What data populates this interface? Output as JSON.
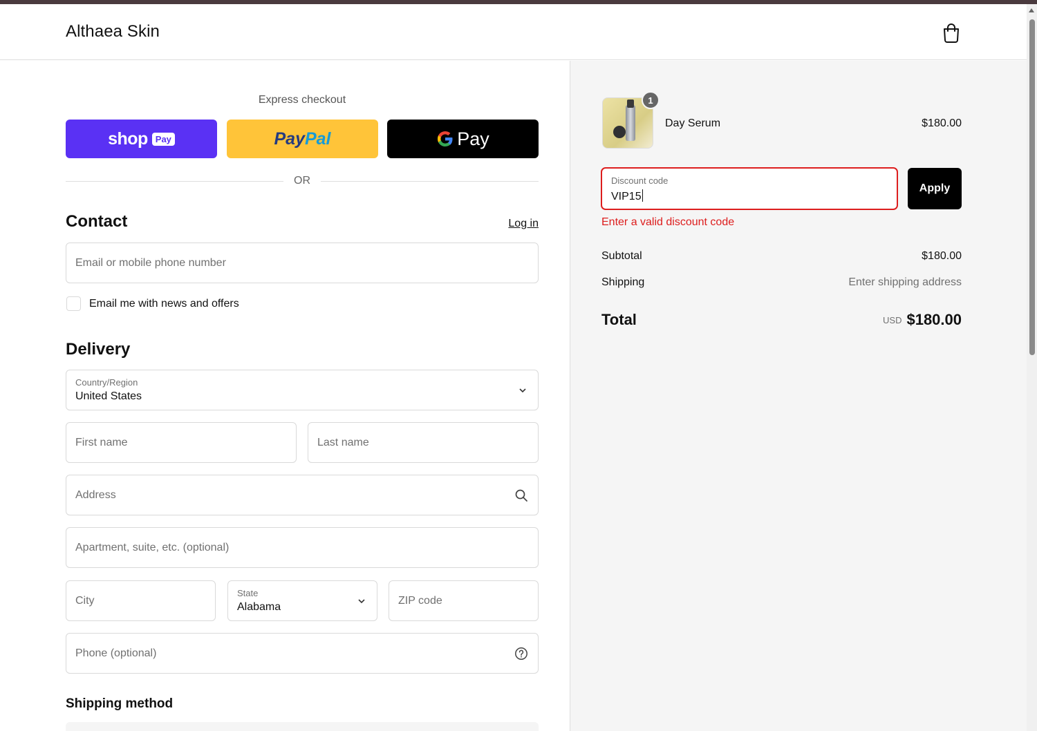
{
  "header": {
    "brand": "Althaea Skin",
    "cart_icon": "shopping-bag-icon"
  },
  "express": {
    "label": "Express checkout",
    "shop_pay": {
      "text": "shop",
      "pill": "Pay",
      "color": "#5a31f4"
    },
    "paypal": {
      "part1": "Pay",
      "part2": "Pal",
      "color": "#ffc439"
    },
    "gpay": {
      "text": "Pay",
      "color": "#000000"
    },
    "or_text": "OR"
  },
  "contact": {
    "title": "Contact",
    "login": "Log in",
    "email_placeholder": "Email or mobile phone number",
    "newsletter_label": "Email me with news and offers"
  },
  "delivery": {
    "title": "Delivery",
    "country_label": "Country/Region",
    "country_value": "United States",
    "first_name_placeholder": "First name",
    "last_name_placeholder": "Last name",
    "address_placeholder": "Address",
    "apartment_placeholder": "Apartment, suite, etc. (optional)",
    "city_placeholder": "City",
    "state_label": "State",
    "state_value": "Alabama",
    "zip_placeholder": "ZIP code",
    "phone_placeholder": "Phone (optional)"
  },
  "shipping_method": {
    "title": "Shipping method"
  },
  "summary": {
    "item": {
      "name": "Day Serum",
      "price": "$180.00",
      "quantity": "1"
    },
    "discount_label": "Discount code",
    "discount_value": "VIP15",
    "apply_label": "Apply",
    "discount_error": "Enter a valid discount code",
    "subtotal_label": "Subtotal",
    "subtotal_value": "$180.00",
    "shipping_label": "Shipping",
    "shipping_value": "Enter shipping address",
    "total_label": "Total",
    "currency": "USD",
    "total_value": "$180.00"
  },
  "colors": {
    "error": "#dd1d1d",
    "accent": "#000000",
    "summary_bg": "#f5f5f5"
  }
}
